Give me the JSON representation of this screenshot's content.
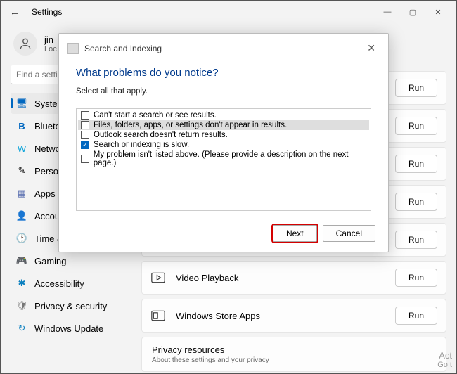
{
  "titlebar": {
    "back": "←",
    "title": "Settings"
  },
  "user": {
    "name": "jin",
    "sub": "Loc"
  },
  "search": {
    "placeholder": "Find a setting"
  },
  "nav": {
    "items": [
      {
        "label": "System",
        "icon": "🖥"
      },
      {
        "label": "Bluetoo",
        "icon": "B"
      },
      {
        "label": "Network",
        "icon": "W"
      },
      {
        "label": "Persona",
        "icon": "✎"
      },
      {
        "label": "Apps",
        "icon": "▦"
      },
      {
        "label": "Account",
        "icon": "👤"
      },
      {
        "label": "Time &",
        "icon": "🕑"
      },
      {
        "label": "Gaming",
        "icon": "🎮"
      },
      {
        "label": "Accessibility",
        "icon": "✱"
      },
      {
        "label": "Privacy & security",
        "icon": "🛡"
      },
      {
        "label": "Windows Update",
        "icon": "↻"
      }
    ]
  },
  "panels": [
    {
      "label": "",
      "run": "Run"
    },
    {
      "label": "",
      "run": "Run"
    },
    {
      "label": "",
      "run": "Run"
    },
    {
      "label": "",
      "run": "Run"
    },
    {
      "label": "",
      "run": "Run"
    },
    {
      "label": "Video Playback",
      "run": "Run",
      "icon": "▷"
    },
    {
      "label": "Windows Store Apps",
      "run": "Run",
      "icon": "⊞"
    }
  ],
  "privacy": {
    "title": "Privacy resources",
    "sub": "About these settings and your privacy"
  },
  "watermark": {
    "l1": "Act",
    "l2": "Go t"
  },
  "dialog": {
    "title": "Search and Indexing",
    "question": "What problems do you notice?",
    "subtitle": "Select all that apply.",
    "options": [
      {
        "label": "Can't start a search or see results.",
        "checked": false,
        "selected": false
      },
      {
        "label": "Files, folders, apps, or settings don't appear in results.",
        "checked": false,
        "selected": true
      },
      {
        "label": "Outlook search doesn't return results.",
        "checked": false,
        "selected": false
      },
      {
        "label": "Search or indexing is slow.",
        "checked": true,
        "selected": false
      },
      {
        "label": "My problem isn't listed above. (Please provide a description on the next page.)",
        "checked": false,
        "selected": false
      }
    ],
    "next": "Next",
    "cancel": "Cancel"
  }
}
